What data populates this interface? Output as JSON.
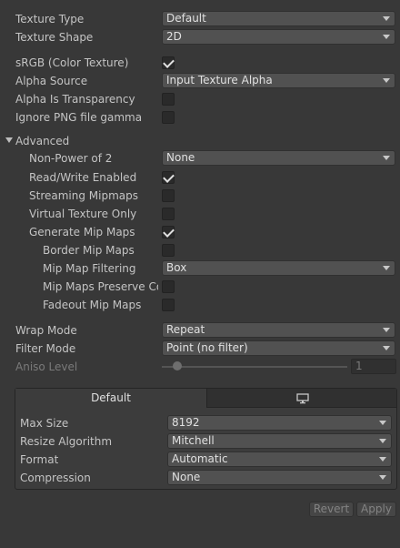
{
  "texture_type": {
    "label": "Texture Type",
    "value": "Default"
  },
  "texture_shape": {
    "label": "Texture Shape",
    "value": "2D"
  },
  "srgb": {
    "label": "sRGB (Color Texture)",
    "checked": true
  },
  "alpha_source": {
    "label": "Alpha Source",
    "value": "Input Texture Alpha"
  },
  "alpha_is_transparency": {
    "label": "Alpha Is Transparency",
    "checked": false
  },
  "ignore_png_gamma": {
    "label": "Ignore PNG file gamma",
    "checked": false
  },
  "advanced": {
    "label": "Advanced",
    "non_power_of_2": {
      "label": "Non-Power of 2",
      "value": "None"
    },
    "read_write": {
      "label": "Read/Write Enabled",
      "checked": true
    },
    "streaming_mipmaps": {
      "label": "Streaming Mipmaps",
      "checked": false
    },
    "virtual_texture_only": {
      "label": "Virtual Texture Only",
      "checked": false
    },
    "generate_mip_maps": {
      "label": "Generate Mip Maps",
      "checked": true
    },
    "border_mip_maps": {
      "label": "Border Mip Maps",
      "checked": false
    },
    "mip_map_filtering": {
      "label": "Mip Map Filtering",
      "value": "Box"
    },
    "mip_maps_preserve_coverage": {
      "label": "Mip Maps Preserve Coverage",
      "checked": false
    },
    "fadeout_mip_maps": {
      "label": "Fadeout Mip Maps",
      "checked": false
    }
  },
  "wrap_mode": {
    "label": "Wrap Mode",
    "value": "Repeat"
  },
  "filter_mode": {
    "label": "Filter Mode",
    "value": "Point (no filter)"
  },
  "aniso_level": {
    "label": "Aniso Level",
    "value": "1"
  },
  "platform": {
    "tab_default": "Default",
    "tab_standalone_icon": "monitor-icon",
    "max_size": {
      "label": "Max Size",
      "value": "8192"
    },
    "resize_algorithm": {
      "label": "Resize Algorithm",
      "value": "Mitchell"
    },
    "format": {
      "label": "Format",
      "value": "Automatic"
    },
    "compression": {
      "label": "Compression",
      "value": "None"
    }
  },
  "buttons": {
    "revert": "Revert",
    "apply": "Apply"
  },
  "colors": {
    "background": "#383838",
    "field": "#515151",
    "text": "#c4c4c4"
  }
}
